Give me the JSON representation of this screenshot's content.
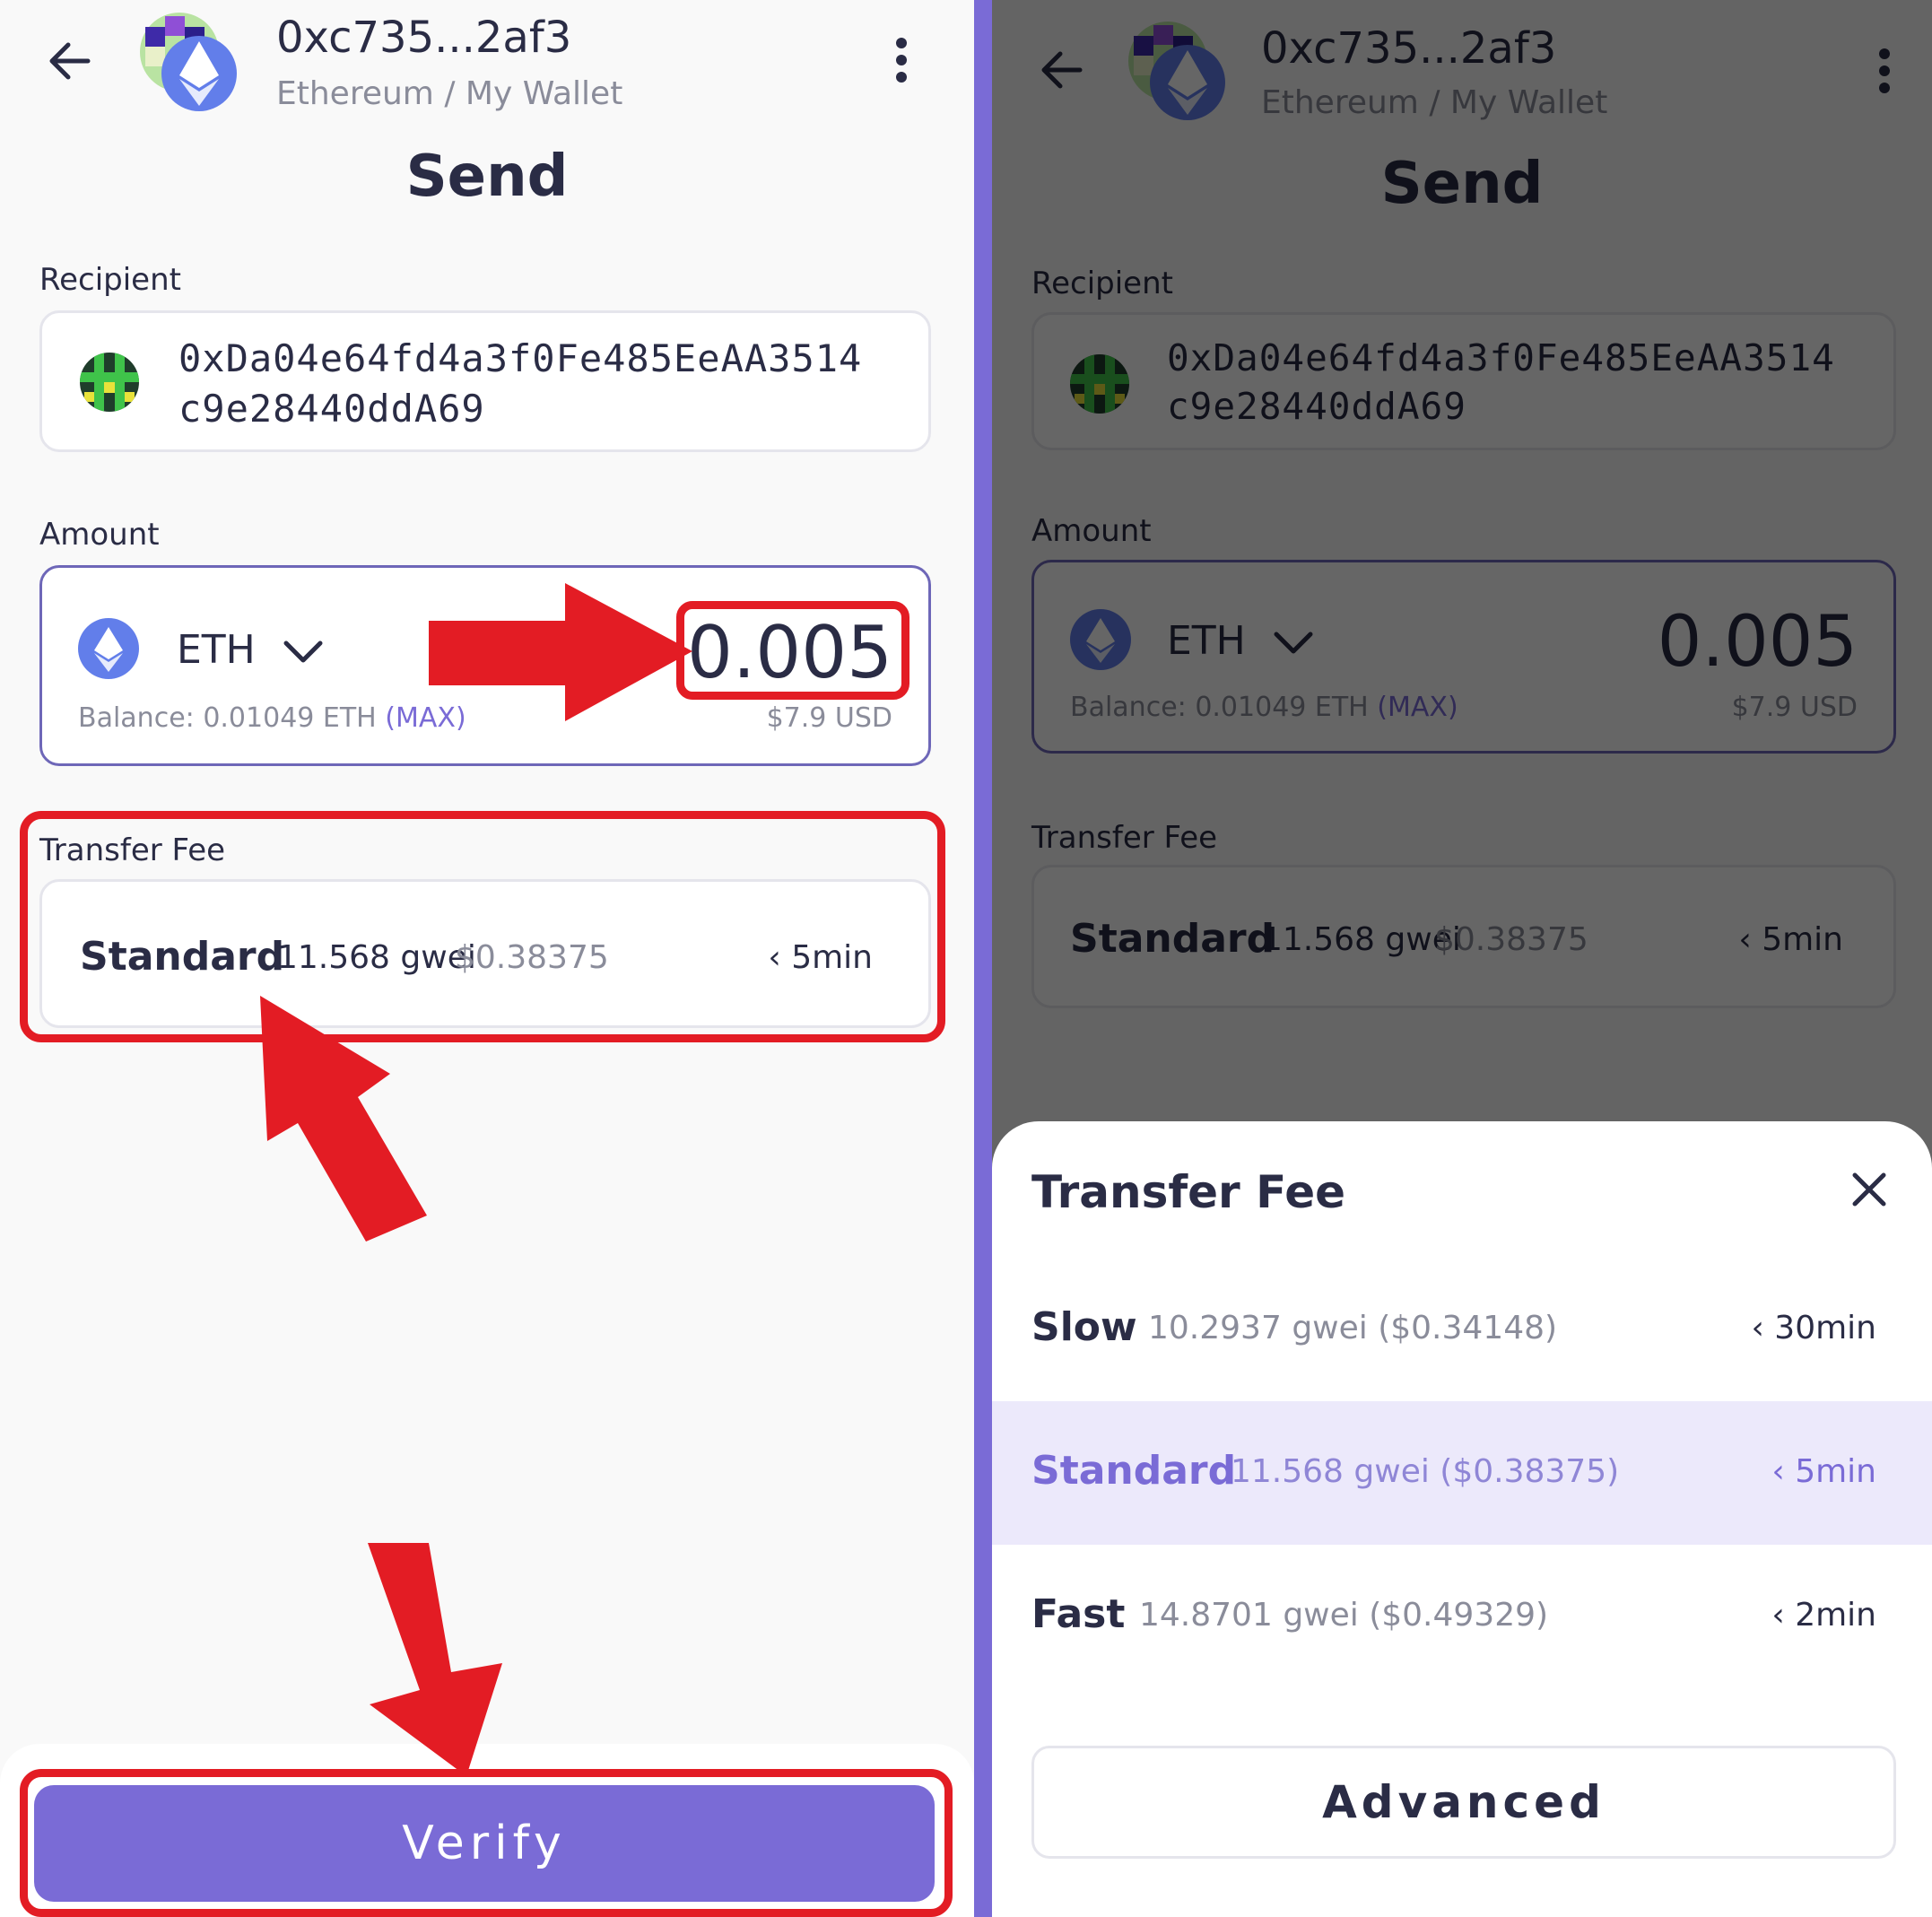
{
  "header": {
    "address": "0xc735...2af3",
    "subtitle": "Ethereum / My Wallet",
    "title": "Send"
  },
  "recipient": {
    "label": "Recipient",
    "address_line1": "0xDa04e64fd4a3f0Fe485EeAA3514",
    "address_line2": "c9e28440ddA69"
  },
  "amount": {
    "label": "Amount",
    "token": "ETH",
    "value": "0.005",
    "balance_label": "Balance:",
    "balance_value": "0.01049 ETH",
    "max_label": "(MAX)",
    "usd": "$7.9 USD"
  },
  "fee": {
    "label": "Transfer Fee",
    "speed": "Standard",
    "gwei": "11.568 gwei",
    "usd": "$0.38375",
    "time": "‹ 5min"
  },
  "verify_label": "Verify",
  "sheet": {
    "title": "Transfer Fee",
    "options": [
      {
        "name": "Slow",
        "detail": "10.2937 gwei  ($0.34148)",
        "time": "‹ 30min"
      },
      {
        "name": "Standard",
        "detail": "11.568 gwei  ($0.38375)",
        "time": "‹ 5min",
        "selected": true
      },
      {
        "name": "Fast",
        "detail": "14.8701 gwei  ($0.49329)",
        "time": "‹ 2min"
      }
    ],
    "advanced_label": "Advanced"
  },
  "colors": {
    "accent": "#7a6bd6",
    "annotation_red": "#e31c24",
    "eth_blue": "#627eea",
    "text_dark": "#2a2c45"
  }
}
